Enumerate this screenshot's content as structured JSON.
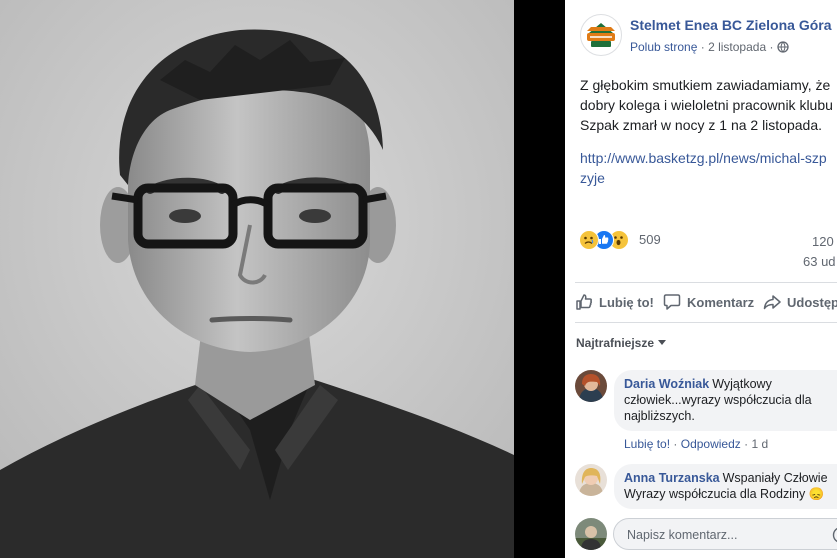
{
  "photo": {
    "alt": "Czarno-białe zdjęcie portretowe mężczyzny w okularach"
  },
  "post": {
    "page_name": "Stelmet Enea BC Zielona Góra",
    "like_page": "Polub stronę",
    "separator": "·",
    "date": "2 listopada",
    "text_lines": [
      "Z głębokim smutkiem zawiadamiamy, że",
      "dobry kolega i wieloletni pracownik klubu",
      "Szpak zmarł w nocy z 1 na 2 listopada."
    ],
    "link_lines": [
      "http://www.basketzg.pl/news/michal-szp",
      "zyje"
    ],
    "reactions_count": "509",
    "comments_count": "120",
    "shares_count": "63 ud"
  },
  "actions": {
    "like": "Lubię to!",
    "comment": "Komentarz",
    "share": "Udostęp"
  },
  "sort_label": "Najtrafniejsze",
  "comments": [
    {
      "author": "Daria Woźniak",
      "text_lines": [
        "Wyjątkowy",
        "człowiek...wyrazy współczucia dla",
        "najbliższych."
      ],
      "like": "Lubię to!",
      "reply": "Odpowiedz",
      "time": "1 d"
    },
    {
      "author": "Anna Turzanska",
      "text_lines": [
        "Wspaniały Człowie",
        "Wyrazy współczucia dla Rodziny"
      ],
      "emoji": "😞"
    }
  ],
  "composer": {
    "placeholder": "Napisz komentarz..."
  },
  "colors": {
    "link": "#385898",
    "text": "#1c1e21",
    "meta": "#616770",
    "bubble": "#f2f3f5",
    "photo_bg": "#000000"
  }
}
